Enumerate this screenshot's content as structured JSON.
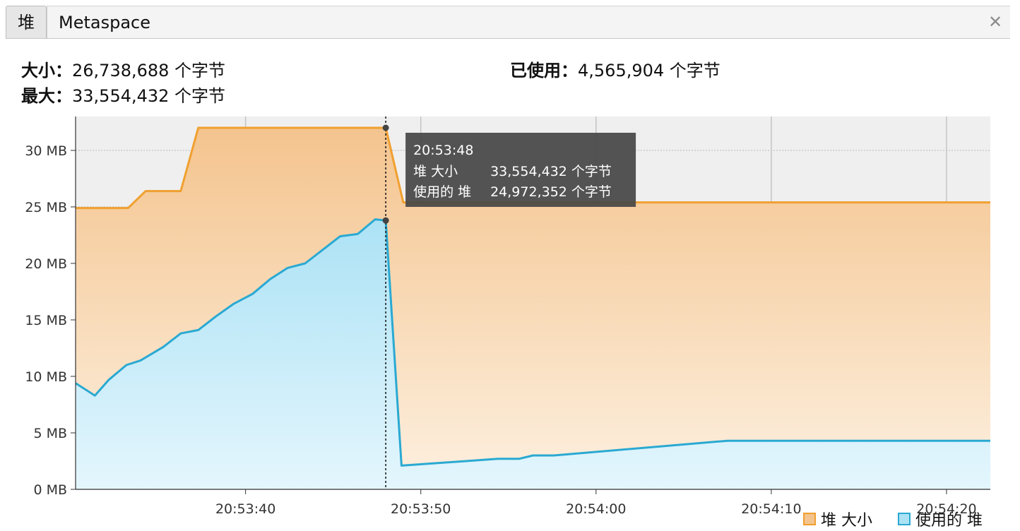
{
  "tabs": [
    {
      "label": "堆",
      "active": true
    },
    {
      "label": "Metaspace",
      "active": false
    }
  ],
  "close_icon": "close-icon",
  "stats": {
    "size_label": "大小：",
    "size_value": "26,738,688 个字节",
    "max_label": "最大：",
    "max_value": "33,554,432 个字节",
    "used_label": "已使用：",
    "used_value": "4,565,904 个字节"
  },
  "tooltip": {
    "time": "20:53:48",
    "row1_label": "堆 大小",
    "row1_value": "33,554,432 个字节",
    "row2_label": "使用的 堆",
    "row2_value": "24,972,352 个字节"
  },
  "legend": {
    "heap_size": "堆 大小",
    "heap_used": "使用的 堆"
  },
  "colors": {
    "heap_size": "#f0a030",
    "heap_used": "#2aa9d2"
  },
  "chart_data": {
    "type": "area",
    "xlabel": "",
    "ylabel": "",
    "x_ticks": [
      "20:53:40",
      "20:53:50",
      "20:54:00",
      "20:54:10",
      "20:54:20"
    ],
    "y_ticks": [
      "0 MB",
      "5 MB",
      "10 MB",
      "15 MB",
      "20 MB",
      "25 MB",
      "30 MB"
    ],
    "y_unit": "MB",
    "ylim": [
      0,
      33
    ],
    "xlim_seconds_from_20_53_00": [
      30.3,
      82.5
    ],
    "grid": true,
    "crosshair_at": "20:53:48",
    "series": [
      {
        "name": "堆 大小",
        "points": [
          [
            "20:53:30.3",
            24.9
          ],
          [
            "20:53:33.3",
            24.9
          ],
          [
            "20:53:34.3",
            26.4
          ],
          [
            "20:53:36.3",
            26.4
          ],
          [
            "20:53:37.3",
            32.0
          ],
          [
            "20:53:48.0",
            32.0
          ],
          [
            "20:53:49.0",
            25.4
          ],
          [
            "20:54:22.5",
            25.4
          ]
        ]
      },
      {
        "name": "使用的 堆",
        "points": [
          [
            "20:53:30.3",
            9.4
          ],
          [
            "20:53:31.4",
            8.3
          ],
          [
            "20:53:32.2",
            9.7
          ],
          [
            "20:53:33.2",
            11.0
          ],
          [
            "20:53:34.0",
            11.4
          ],
          [
            "20:53:35.3",
            12.6
          ],
          [
            "20:53:36.3",
            13.8
          ],
          [
            "20:53:37.3",
            14.1
          ],
          [
            "20:53:38.3",
            15.3
          ],
          [
            "20:53:39.3",
            16.4
          ],
          [
            "20:53:40.4",
            17.3
          ],
          [
            "20:53:41.4",
            18.6
          ],
          [
            "20:53:42.4",
            19.6
          ],
          [
            "20:53:43.4",
            20.0
          ],
          [
            "20:53:44.4",
            21.2
          ],
          [
            "20:53:45.4",
            22.4
          ],
          [
            "20:53:46.4",
            22.6
          ],
          [
            "20:53:47.4",
            23.9
          ],
          [
            "20:53:48.0",
            23.8
          ],
          [
            "20:53:48.9",
            2.1
          ],
          [
            "20:53:54.4",
            2.7
          ],
          [
            "20:53:55.6",
            2.7
          ],
          [
            "20:53:56.4",
            3.0
          ],
          [
            "20:53:57.6",
            3.0
          ],
          [
            "20:54:07.5",
            4.3
          ],
          [
            "20:54:22.5",
            4.3
          ]
        ]
      }
    ]
  }
}
